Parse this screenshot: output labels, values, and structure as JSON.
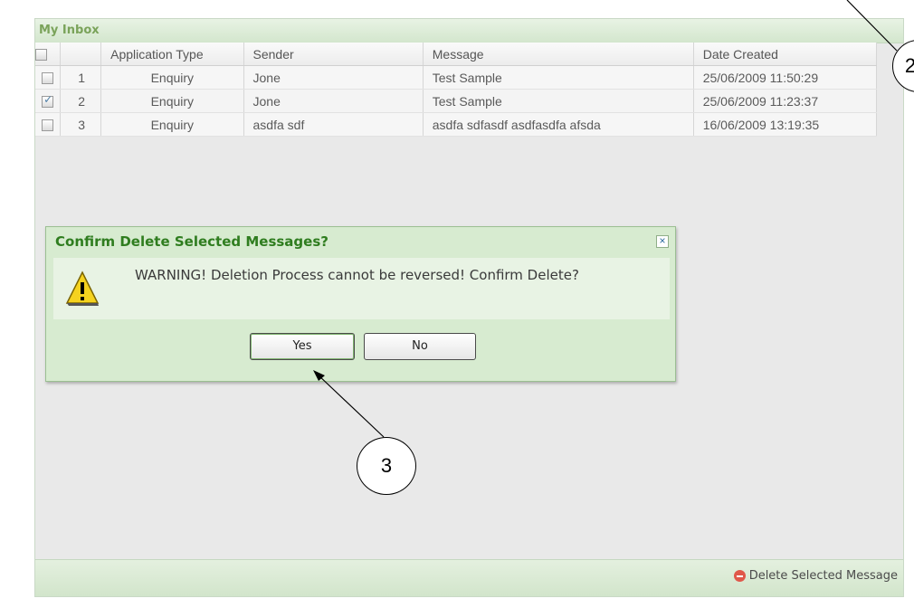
{
  "inbox": {
    "title": "My Inbox",
    "columns": [
      "Application Type",
      "Sender",
      "Message",
      "Date Created"
    ],
    "rows": [
      {
        "num": "1",
        "type": "Enquiry",
        "sender": "Jone",
        "message": "Test Sample",
        "date": "25/06/2009 11:50:29",
        "checked": false
      },
      {
        "num": "2",
        "type": "Enquiry",
        "sender": "Jone",
        "message": "Test Sample",
        "date": "25/06/2009 11:23:37",
        "checked": true
      },
      {
        "num": "3",
        "type": "Enquiry",
        "sender": "asdfa sdf",
        "message": "asdfa sdfasdf asdfasdfa afsda",
        "date": "16/06/2009 13:19:35",
        "checked": false
      }
    ],
    "footer": {
      "delete_label": "Delete Selected Message",
      "delete_icon": "minus-circle-icon"
    }
  },
  "dialog": {
    "title": "Confirm Delete Selected Messages?",
    "message": "WARNING! Deletion Process cannot be reversed! Confirm Delete?",
    "close_glyph": "×",
    "icon": "warning-icon",
    "yes_label": "Yes",
    "no_label": "No"
  },
  "callouts": {
    "c3": "3",
    "c2": "2"
  },
  "colors": {
    "accent_green": "#2f7d1f",
    "header_green": "#7aa35a",
    "dialog_bg": "#d7ebd0",
    "delete_red": "#e0584a"
  }
}
